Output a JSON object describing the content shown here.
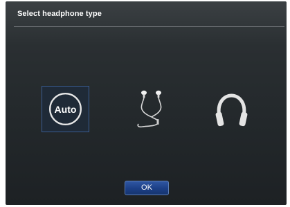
{
  "dialog": {
    "title": "Select headphone type",
    "options": [
      {
        "id": "auto",
        "label": "Auto",
        "selected": true,
        "icon": "auto-icon"
      },
      {
        "id": "earphones",
        "selected": false,
        "icon": "earphones-icon"
      },
      {
        "id": "headphones",
        "selected": false,
        "icon": "headphones-icon"
      }
    ],
    "ok_label": "OK"
  },
  "colors": {
    "background": "#23282b",
    "selection_border": "#3a5d93",
    "button": "#1c3f86",
    "text": "#ffffff"
  }
}
